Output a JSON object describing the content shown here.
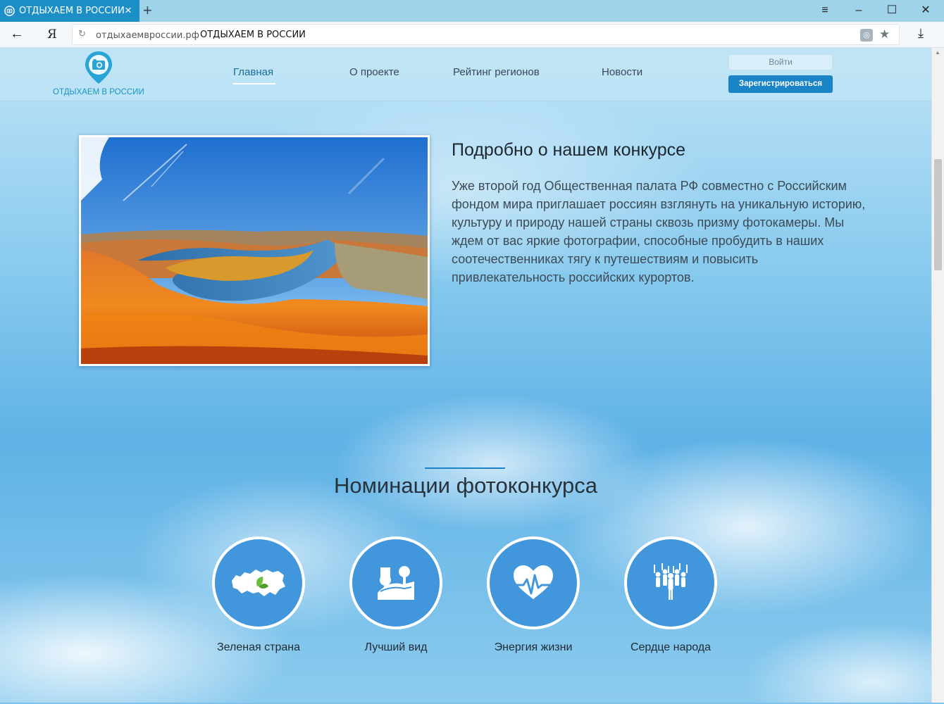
{
  "browser": {
    "tab_title": "ОТДЫХАЕМ В РОССИИ",
    "url_domain": "отдыхаемвроссии.рф",
    "page_title": "ОТДЫХАЕМ В РОССИИ",
    "ya_label": "Я"
  },
  "header": {
    "logo_text": "ОТДЫХАЕМ В РОССИИ",
    "nav": [
      "Главная",
      "О проекте",
      "Рейтинг регионов",
      "Новости"
    ],
    "active_nav": "Главная",
    "login_label": "Войти",
    "register_label": "Зарегистрироваться"
  },
  "about": {
    "title": "Подробно о нашем конкурсе",
    "text": "Уже второй год Общественная палата РФ совместно с Российским фондом мира приглашает россиян взглянуть на уникальную историю, культуру и природу нашей страны сквозь призму фотокамеры. Мы ждем от вас яркие фотографии, способные пробудить в наших соотечественниках тягу к путешествиям и повысить привлекательность российских курортов."
  },
  "nominations": {
    "title": "Номинации фотоконкурса",
    "items": [
      {
        "label": "Зеленая страна",
        "icon": "russia-map-leaf-icon"
      },
      {
        "label": "Лучший вид",
        "icon": "landscape-trees-icon"
      },
      {
        "label": "Энергия жизни",
        "icon": "heart-pulse-icon"
      },
      {
        "label": "Сердце народа",
        "icon": "crowd-people-icon"
      }
    ]
  },
  "colors": {
    "accent": "#1a84c7",
    "circle": "#4196dc",
    "tab": "#1d8fc7"
  }
}
